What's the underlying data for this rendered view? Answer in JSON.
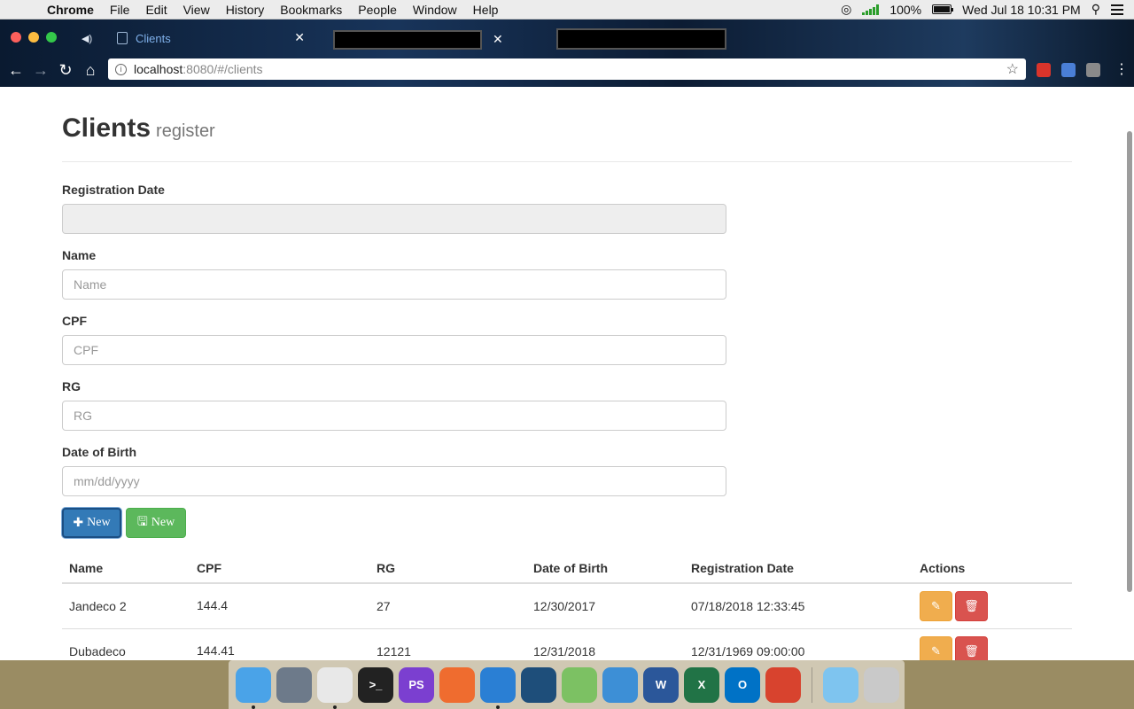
{
  "menubar": {
    "app": "Chrome",
    "items": [
      "File",
      "Edit",
      "View",
      "History",
      "Bookmarks",
      "People",
      "Window",
      "Help"
    ],
    "battery": "100%",
    "clock": "Wed Jul 18  10:31 PM"
  },
  "browser": {
    "tab_title": "Clients",
    "url_host": "localhost",
    "url_path": ":8080/#/clients",
    "ext_colors": [
      "#d9342b",
      "#4a7fd6",
      "#8a8a8a"
    ]
  },
  "page": {
    "title": "Clients",
    "subtitle": "register",
    "form": {
      "registration_date": {
        "label": "Registration Date",
        "value": "",
        "placeholder": ""
      },
      "name": {
        "label": "Name",
        "value": "",
        "placeholder": "Name"
      },
      "cpf": {
        "label": "CPF",
        "value": "",
        "placeholder": "CPF"
      },
      "rg": {
        "label": "RG",
        "value": "",
        "placeholder": "RG"
      },
      "dob": {
        "label": "Date of Birth",
        "value": "",
        "placeholder": "mm/dd/yyyy"
      }
    },
    "buttons": {
      "new_label": "New",
      "save_label": "New"
    },
    "table": {
      "headers": [
        "Name",
        "CPF",
        "RG",
        "Date of Birth",
        "Registration Date",
        "Actions"
      ],
      "rows": [
        {
          "name": "Jandeco 2",
          "cpf": "144.4",
          "rg": "27",
          "dob": "12/30/2017",
          "registered": "07/18/2018 12:33:45"
        },
        {
          "name": "Dubadeco",
          "cpf": "144.41",
          "rg": "12121",
          "dob": "12/31/2018",
          "registered": "12/31/1969 09:00:00"
        }
      ]
    }
  },
  "dock": {
    "apps": [
      {
        "name": "Finder",
        "label": "",
        "color": "#4aa3e8"
      },
      {
        "name": "Launchpad",
        "label": "",
        "color": "#6d7a8a"
      },
      {
        "name": "Chrome",
        "label": "",
        "color": "#e8e8e8"
      },
      {
        "name": "Terminal",
        "label": ">_",
        "color": "#222222"
      },
      {
        "name": "PhpStorm",
        "label": "PS",
        "color": "#7b3fd0"
      },
      {
        "name": "Postman",
        "label": "",
        "color": "#ef6c2f"
      },
      {
        "name": "VS Code",
        "label": "",
        "color": "#2a7fd4"
      },
      {
        "name": "MySQL Workbench",
        "label": "",
        "color": "#1e4e7a"
      },
      {
        "name": "Android Studio",
        "label": "",
        "color": "#7cc163"
      },
      {
        "name": "Xcode",
        "label": "",
        "color": "#3d8fd6"
      },
      {
        "name": "Word",
        "label": "W",
        "color": "#2b579a"
      },
      {
        "name": "Excel",
        "label": "X",
        "color": "#217346"
      },
      {
        "name": "Outlook",
        "label": "O",
        "color": "#0072c6"
      },
      {
        "name": "Remote Desktop",
        "label": "",
        "color": "#d8432e"
      },
      {
        "name": "Folder",
        "label": "",
        "color": "#7ec4ef"
      },
      {
        "name": "Trash",
        "label": "",
        "color": "#c9c9c9"
      }
    ]
  }
}
